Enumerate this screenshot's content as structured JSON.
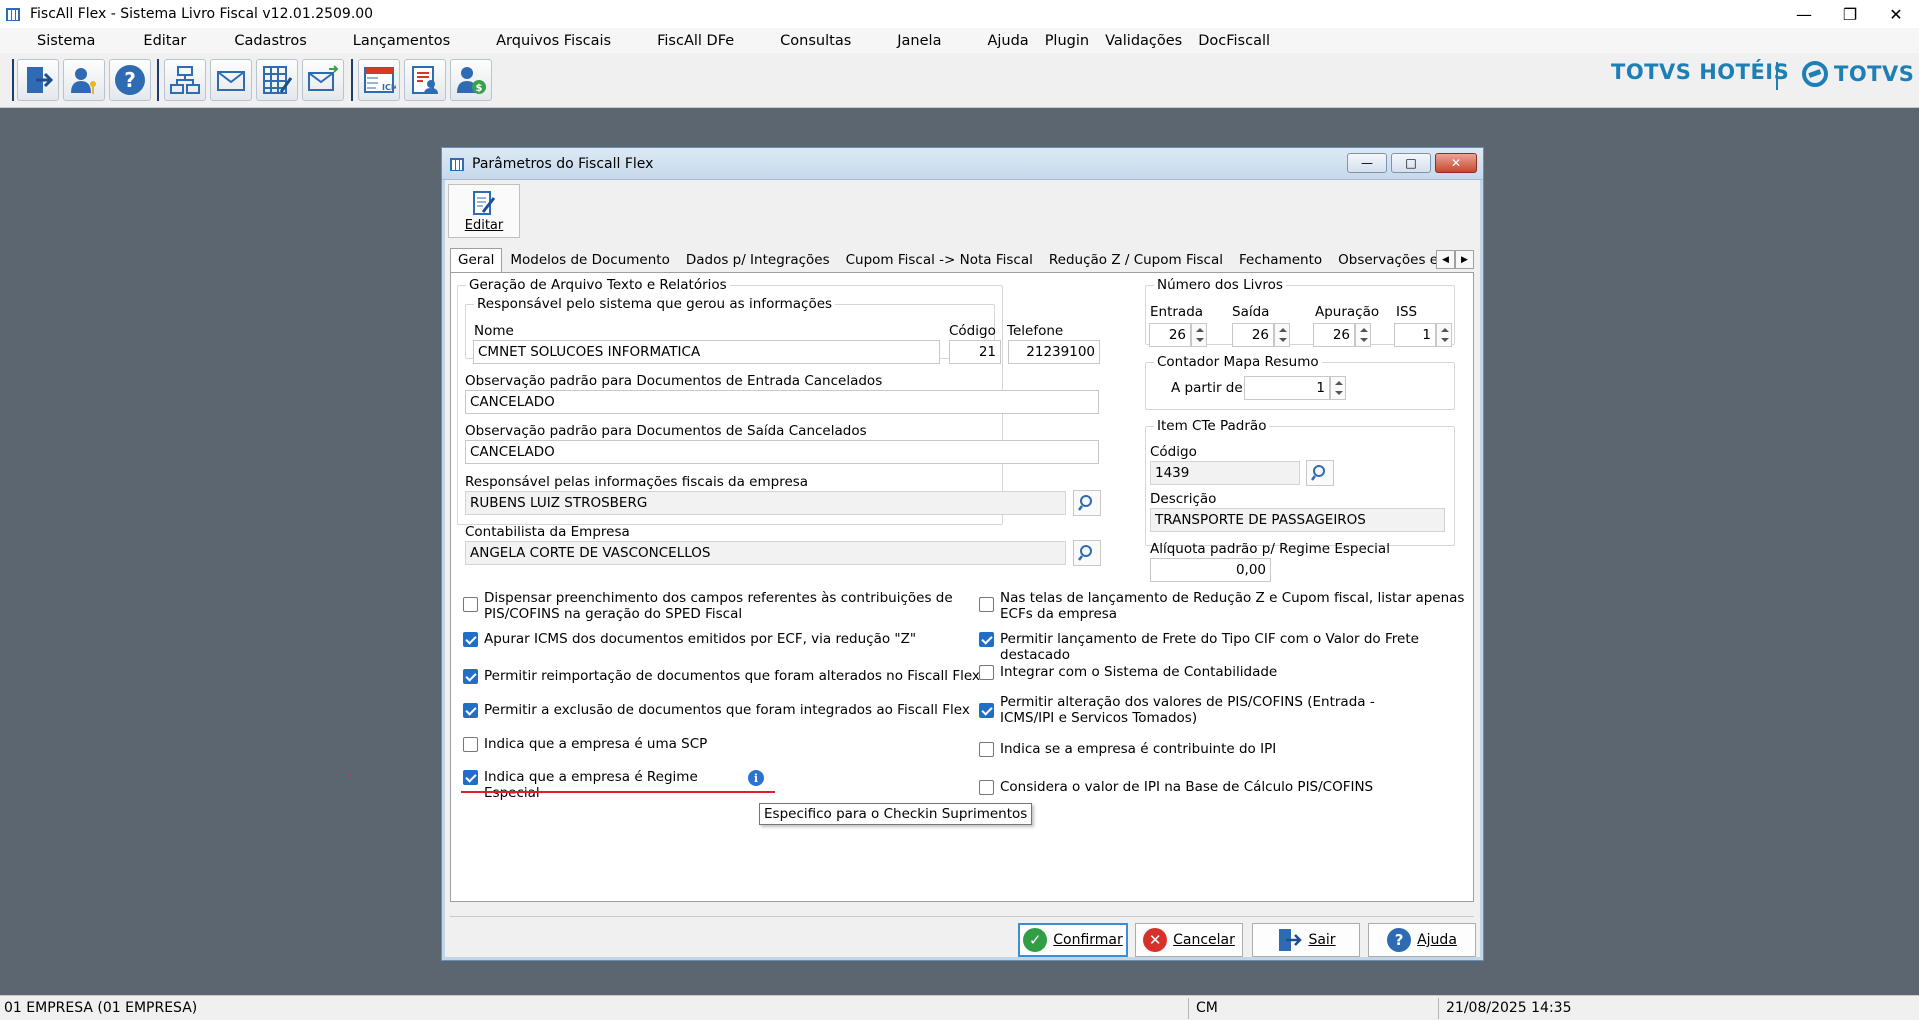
{
  "window": {
    "title": "FiscAll Flex - Sistema Livro Fiscal v12.01.2509.00",
    "controls": [
      "minimize",
      "restore",
      "close"
    ]
  },
  "menu": [
    "Sistema",
    "Editar",
    "Cadastros",
    "Lançamentos",
    "Arquivos Fiscais",
    "FiscAll DFe",
    "Consultas",
    "Janela",
    "Ajuda",
    "Plugin",
    "Validações",
    "DocFiscall"
  ],
  "toolbar": {
    "icons": [
      "exit-icon",
      "user-key-icon",
      "help-icon",
      "network-icon",
      "mail-open-icon",
      "spreadsheet-edit-icon",
      "mail-send-icon",
      "icms-table-icon",
      "document-user-icon",
      "user-money-icon"
    ],
    "brand_left": "TOTVS HOTÉIS",
    "brand_right": "TOTVS"
  },
  "dialog": {
    "title": "Parâmetros do Fiscall Flex",
    "edit_label": "Editar",
    "tabs": [
      "Geral",
      "Modelos de Documento",
      "Dados p/ Integrações",
      "Cupom Fiscal -> Nota Fiscal",
      "Redução Z / Cupom Fiscal",
      "Fechamento",
      "Observações e Ajus"
    ],
    "active_tab": "Geral",
    "geracao": {
      "group_label": "Geração de Arquivo Texto e Relatórios",
      "responsavel_group": "Responsável pelo sistema que gerou as informações",
      "nome_label": "Nome",
      "nome_value": "CMNET SOLUCOES INFORMATICA",
      "codigo_label": "Código",
      "codigo_value": "21",
      "telefone_label": "Telefone",
      "telefone_value": "21239100",
      "obs_entrada_label": "Observação padrão para Documentos de Entrada Cancelados",
      "obs_entrada_value": "CANCELADO",
      "obs_saida_label": "Observação padrão para Documentos de Saída Cancelados",
      "obs_saida_value": "CANCELADO",
      "resp_fiscal_label": "Responsável pelas informações fiscais da empresa",
      "resp_fiscal_value": "RUBENS LUIZ STROSBERG",
      "contabilista_label": "Contabilista da Empresa",
      "contabilista_value": "ANGELA CORTE DE VASCONCELLOS"
    },
    "livros": {
      "group_label": "Número dos Livros",
      "entrada_label": "Entrada",
      "entrada_value": "26",
      "saida_label": "Saída",
      "saida_value": "26",
      "apuracao_label": "Apuração",
      "apuracao_value": "26",
      "iss_label": "ISS",
      "iss_value": "1"
    },
    "contador": {
      "group_label": "Contador Mapa Resumo",
      "a_partir_label": "A partir de",
      "a_partir_value": "1"
    },
    "item_cte": {
      "group_label": "Item CTe Padrão",
      "codigo_label": "Código",
      "codigo_value": "1439",
      "descricao_label": "Descrição",
      "descricao_value": "TRANSPORTE DE PASSAGEIROS"
    },
    "aliquota": {
      "label": "Alíquota padrão p/ Regime Especial",
      "value": "0,00"
    },
    "checks_left": [
      {
        "text": "Dispensar preenchimento dos campos referentes às contribuições de PIS/COFINS na geração do SPED Fiscal",
        "checked": false
      },
      {
        "text": "Apurar ICMS dos documentos emitidos por ECF, via redução \"Z\"",
        "checked": true
      },
      {
        "text": "Permitir reimportação de documentos que foram alterados no Fiscall Flex",
        "checked": true
      },
      {
        "text": "Permitir a exclusão de documentos que foram integrados ao Fiscall Flex",
        "checked": true
      },
      {
        "text": "Indica que a empresa é uma SCP",
        "checked": false
      },
      {
        "text": "Indica que a empresa é Regime Especial",
        "checked": true
      }
    ],
    "checks_right": [
      {
        "text": "Nas telas de lançamento de Redução Z e Cupom fiscal, listar apenas ECFs da empresa",
        "checked": false
      },
      {
        "text": "Permitir lançamento de Frete do Tipo CIF com o Valor do Frete destacado",
        "checked": true
      },
      {
        "text": "Integrar com o Sistema de Contabilidade",
        "checked": false
      },
      {
        "text": "Permitir alteração dos valores de PIS/COFINS (Entrada - ICMS/IPI e Servicos Tomados)",
        "checked": true
      },
      {
        "text": "Indica se a empresa é contribuinte do IPI",
        "checked": false
      },
      {
        "text": "Considera o valor de IPI na Base de Cálculo PIS/COFINS",
        "checked": false
      }
    ],
    "tooltip": "Especifico para o Checkin Suprimentos",
    "buttons": {
      "confirmar": "Confirmar",
      "cancelar": "Cancelar",
      "sair": "Sair",
      "ajuda": "Ajuda"
    }
  },
  "statusbar": {
    "empresa": "01 EMPRESA (01 EMPRESA)",
    "mode": "CM",
    "datetime": "21/08/2025 14:35"
  }
}
